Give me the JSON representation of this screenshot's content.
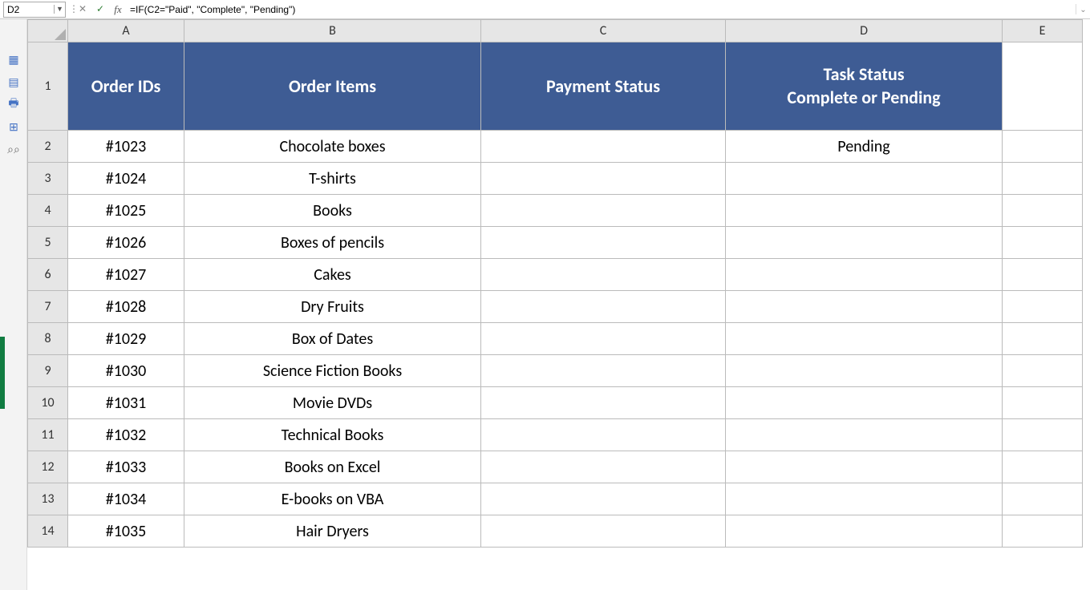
{
  "namebox": "D2",
  "formula": "=IF(C2=\"Paid\", \"Complete\", \"Pending\")",
  "columns": [
    "A",
    "B",
    "C",
    "D",
    "E"
  ],
  "rows": [
    "1",
    "2",
    "3",
    "4",
    "5",
    "6",
    "7",
    "8",
    "9",
    "10",
    "11",
    "12",
    "13",
    "14"
  ],
  "headers": {
    "A": "Order IDs",
    "B": "Order Items",
    "C": "Payment Status",
    "D_line1": "Task Status",
    "D_line2": "Complete or Pending"
  },
  "data": [
    {
      "id": "#1023",
      "item": "Chocolate boxes",
      "pay": "",
      "task": "Pending"
    },
    {
      "id": "#1024",
      "item": "T-shirts",
      "pay": "",
      "task": ""
    },
    {
      "id": "#1025",
      "item": "Books",
      "pay": "",
      "task": ""
    },
    {
      "id": "#1026",
      "item": "Boxes of pencils",
      "pay": "",
      "task": ""
    },
    {
      "id": "#1027",
      "item": "Cakes",
      "pay": "",
      "task": ""
    },
    {
      "id": "#1028",
      "item": "Dry Fruits",
      "pay": "",
      "task": ""
    },
    {
      "id": "#1029",
      "item": "Box of Dates",
      "pay": "",
      "task": ""
    },
    {
      "id": "#1030",
      "item": "Science Fiction Books",
      "pay": "",
      "task": ""
    },
    {
      "id": "#1031",
      "item": "Movie DVDs",
      "pay": "",
      "task": ""
    },
    {
      "id": "#1032",
      "item": "Technical Books",
      "pay": "",
      "task": ""
    },
    {
      "id": "#1033",
      "item": "Books on Excel",
      "pay": "",
      "task": ""
    },
    {
      "id": "#1034",
      "item": "E-books on VBA",
      "pay": "",
      "task": ""
    },
    {
      "id": "#1035",
      "item": "Hair Dryers",
      "pay": "",
      "task": ""
    }
  ],
  "sidebar_icons": [
    "table-icon",
    "row-icon",
    "print-icon",
    "grid-icon",
    "binoculars-icon"
  ]
}
